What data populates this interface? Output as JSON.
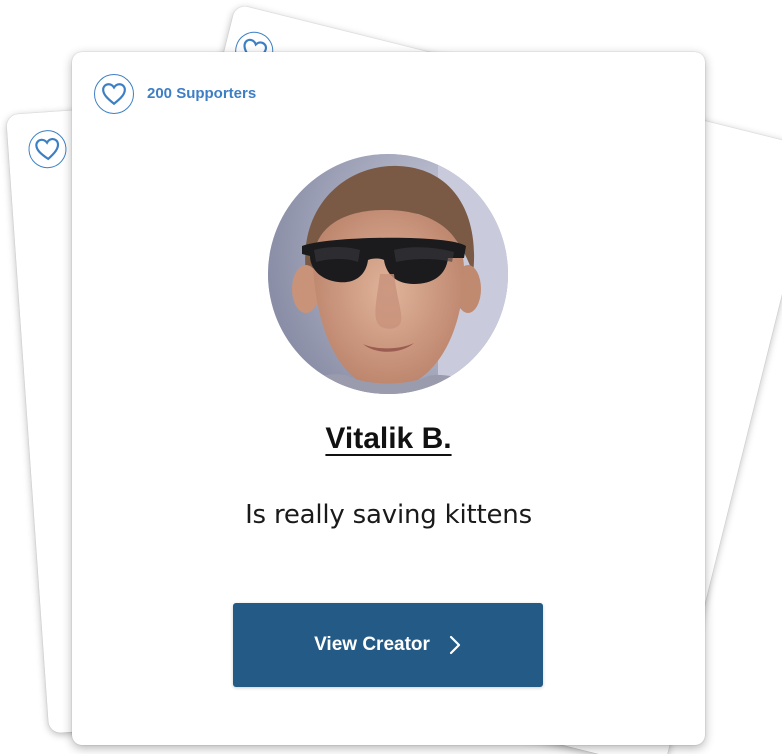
{
  "card": {
    "supporters_label": "200 Supporters",
    "creator_name": "Vitalik B.",
    "tagline": "Is really saving kittens",
    "button_label": "View Creator"
  },
  "icons": {
    "supporters": "heart-icon",
    "button": "chevron-right-icon"
  },
  "colors": {
    "accent_blue": "#3d7fc4",
    "button_bg": "#235a86",
    "button_text": "#ffffff",
    "name_text": "#111111"
  }
}
